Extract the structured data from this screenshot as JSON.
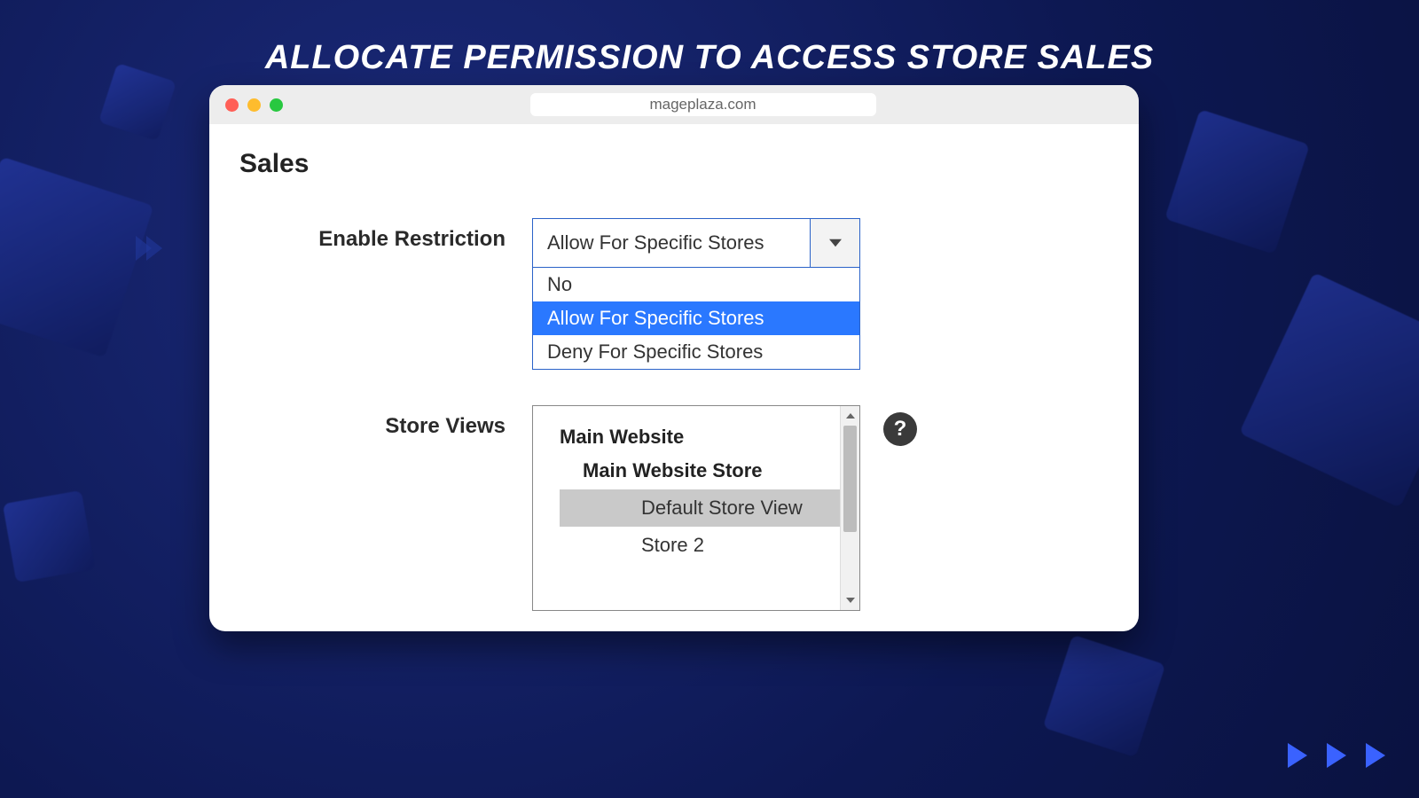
{
  "banner_title": "ALLOCATE PERMISSION TO ACCESS STORE SALES",
  "browser": {
    "url": "mageplaza.com"
  },
  "panel": {
    "section_title": "Sales",
    "enable_restriction": {
      "label": "Enable Restriction",
      "selected": "Allow For Specific Stores",
      "options": [
        "No",
        "Allow For Specific Stores",
        "Deny For Specific Stores"
      ]
    },
    "store_views": {
      "label": "Store Views",
      "group": "Main Website",
      "subgroup": "Main Website Store",
      "items": [
        "Default Store View",
        "Store 2"
      ],
      "selected": "Default Store View"
    },
    "help_glyph": "?"
  }
}
